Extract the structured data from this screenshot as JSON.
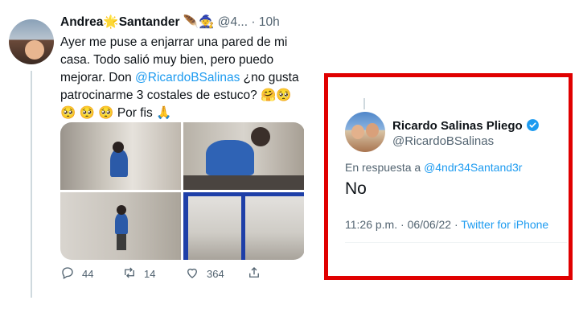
{
  "original_tweet": {
    "display_name": "Andrea",
    "display_name_rest": "Santander",
    "name_emoji_1": "🌟",
    "name_emoji_2": "🪶🧙",
    "handle": "@4...",
    "time": "· 10h",
    "text_1": "Ayer me puse a enjarrar una pared de mi casa. Todo salió muy bien, pero puedo mejorar. Don ",
    "mention": "@RicardoBSalinas",
    "text_2": " ¿no gusta patrocinarme 3 costales de estuco? 🤗🥺",
    "text_3": "🥺 🥺 🥺  Por fis 🙏",
    "photos": [
      "photo-1",
      "photo-2",
      "photo-3",
      "photo-4"
    ],
    "actions": {
      "reply_count": "44",
      "retweet_count": "14",
      "like_count": "364"
    }
  },
  "reply_tweet": {
    "display_name": "Ricardo Salinas Pliego",
    "handle": "@RicardoBSalinas",
    "in_reply_prefix": "En respuesta a",
    "in_reply_handle": "@4ndr34Santand3r",
    "body": "No",
    "time": "11:26 p.m.",
    "date": "06/06/22",
    "separator": "·",
    "client": "Twitter for iPhone"
  },
  "colors": {
    "highlight_box": "#e00000",
    "link_blue": "#1d9bf0",
    "secondary_text": "#536471"
  },
  "icons": [
    "reply-icon",
    "retweet-icon",
    "like-icon",
    "share-icon",
    "verified-badge-icon"
  ]
}
